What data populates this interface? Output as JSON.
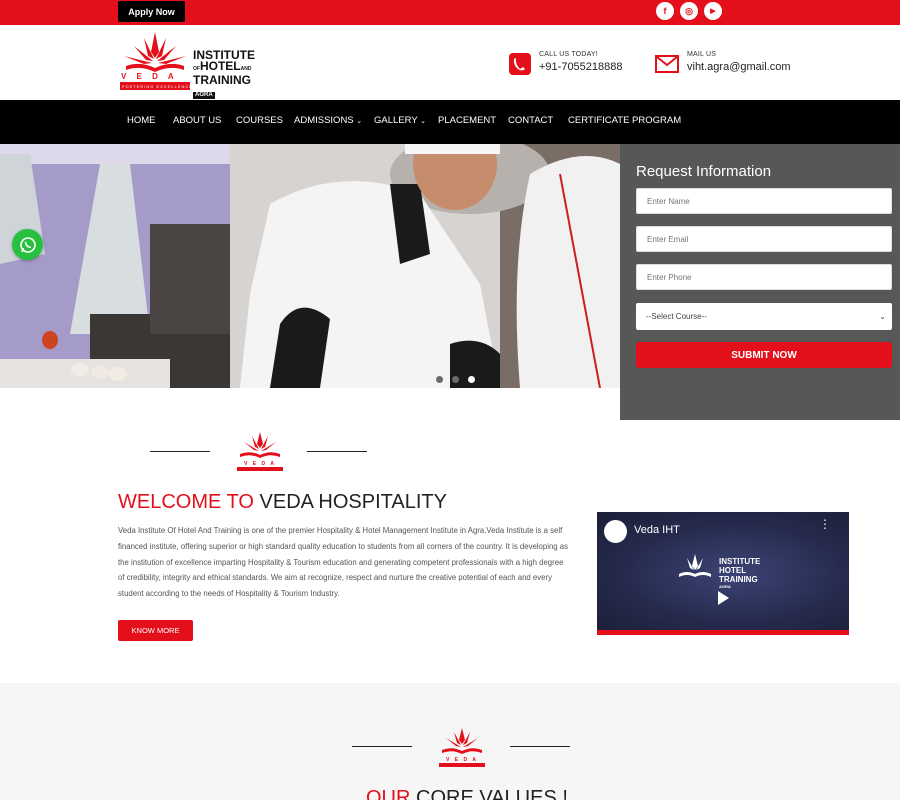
{
  "topbar": {
    "apply_label": "Apply Now",
    "social": [
      {
        "icon": "facebook-icon",
        "glyph": "f"
      },
      {
        "icon": "instagram-icon",
        "glyph": "◎"
      },
      {
        "icon": "youtube-icon",
        "glyph": "▶"
      }
    ]
  },
  "header": {
    "logo": {
      "line1": "INSTITUTE",
      "line2a": "OF",
      "line2b": "HOTEL",
      "line2c": "AND",
      "line3": "TRAINING",
      "line4": "AGRA",
      "veda": "V E D A",
      "tagline": "FOSTERING EXCELLENCE"
    },
    "call_label": "CALL US TODAY!",
    "call_value": "+91-7055218888",
    "mail_label": "MAIL US",
    "mail_value": "viht.agra@gmail.com"
  },
  "nav": {
    "items": [
      "HOME",
      "ABOUT US",
      "COURSES",
      "ADMISSIONS",
      "GALLERY",
      "PLACEMENT",
      "CONTACT",
      "CERTIFICATE PROGRAM"
    ],
    "dropdown_items": [
      "ADMISSIONS",
      "GALLERY"
    ]
  },
  "form": {
    "title": "Request Information",
    "name_placeholder": "Enter Name",
    "email_placeholder": "Enter Email",
    "phone_placeholder": "Enter Phone",
    "course_selected": "--Select Course--",
    "submit_label": "SUBMIT NOW"
  },
  "slider": {
    "slide_count": 3,
    "active_index": 2
  },
  "welcome": {
    "title_red": "WELCOME TO",
    "title_dark": " VEDA HOSPITALITY",
    "body": "Veda Institute Of Hotel And Training is one of the premier Hospitality & Hotel Management Institute in Agra.Veda Institute is a self financed institute, offering superior or high standard quality education to students from all corners of the country. It is developing as the institution of excellence imparting Hospitality & Tourism education and generating competent professionals with a high degree of credibility, integrity and ethical standards. We aim at recognize, respect and nurture the creative potential of each and every student according to the needs of Hospitality & Tourism Industry.",
    "button_label": "KNOW MORE"
  },
  "video": {
    "channel_title": "Veda IHT",
    "menu_glyph": "⋮",
    "logo": {
      "line1": "INSTITUTE",
      "line2": "HOTEL",
      "line3": "TRAINING",
      "line4": "AGRA"
    }
  },
  "core_values": {
    "title_red": "OUR",
    "title_dark": " CORE VALUES !"
  },
  "colors": {
    "brand_red": "#e3101b",
    "nav_black": "#000000",
    "whatsapp_green": "#27c13f"
  }
}
